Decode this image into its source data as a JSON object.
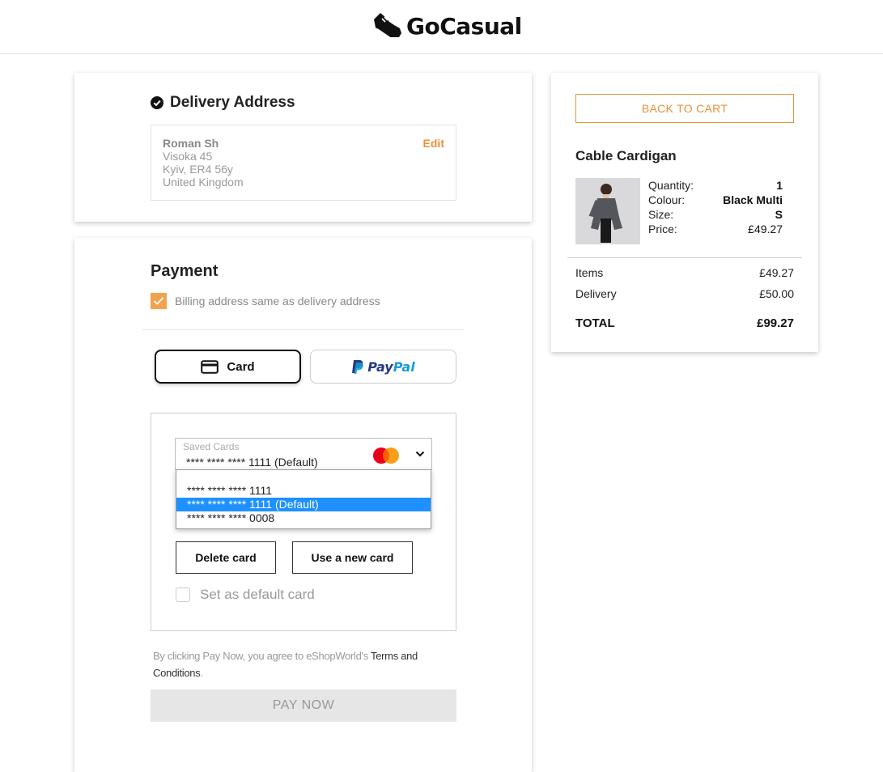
{
  "brand": {
    "name": "GoCasual"
  },
  "delivery": {
    "title": "Delivery Address",
    "name": "Roman Sh",
    "lines": [
      "Visoka 45",
      "Kyiv, ER4 56y",
      "United Kingdom"
    ],
    "edit_label": "Edit"
  },
  "payment": {
    "title": "Payment",
    "billing_same_label": "Billing address same as delivery address",
    "billing_same_checked": true,
    "methods": {
      "card_label": "Card",
      "paypal_pay": "Pay",
      "paypal_pal": "Pal"
    },
    "saved_cards": {
      "label": "Saved Cards",
      "selected": "**** **** **** 1111 (Default)",
      "options": [
        "**** **** **** 1111",
        "**** **** **** 1111 (Default)",
        "**** **** **** 0008"
      ],
      "brand_icon": "mastercard-icon"
    },
    "delete_card_label": "Delete card",
    "new_card_label": "Use a new card",
    "set_default_label": "Set as default card",
    "set_default_checked": false,
    "terms_prefix": "By clicking Pay Now, you agree to eShopWorld's ",
    "terms_link": "Terms and Conditions",
    "terms_suffix": ".",
    "pay_now_label": "PAY NOW"
  },
  "summary": {
    "back_label": "BACK TO CART",
    "product": {
      "name": "Cable Cardigan",
      "rows": [
        {
          "label": "Quantity:",
          "value": "1"
        },
        {
          "label": "Colour:",
          "value": "Black Multi"
        },
        {
          "label": "Size:",
          "value": "S"
        },
        {
          "label": "Price:",
          "value": "£49.27"
        }
      ]
    },
    "items_label": "Items",
    "items_value": "£49.27",
    "delivery_label": "Delivery",
    "delivery_value": "£50.00",
    "total_label": "TOTAL",
    "total_value": "£99.27"
  },
  "colors": {
    "accent": "#e8923a",
    "checkbox": "#f2a24d",
    "selected_option": "#1e90ff"
  }
}
